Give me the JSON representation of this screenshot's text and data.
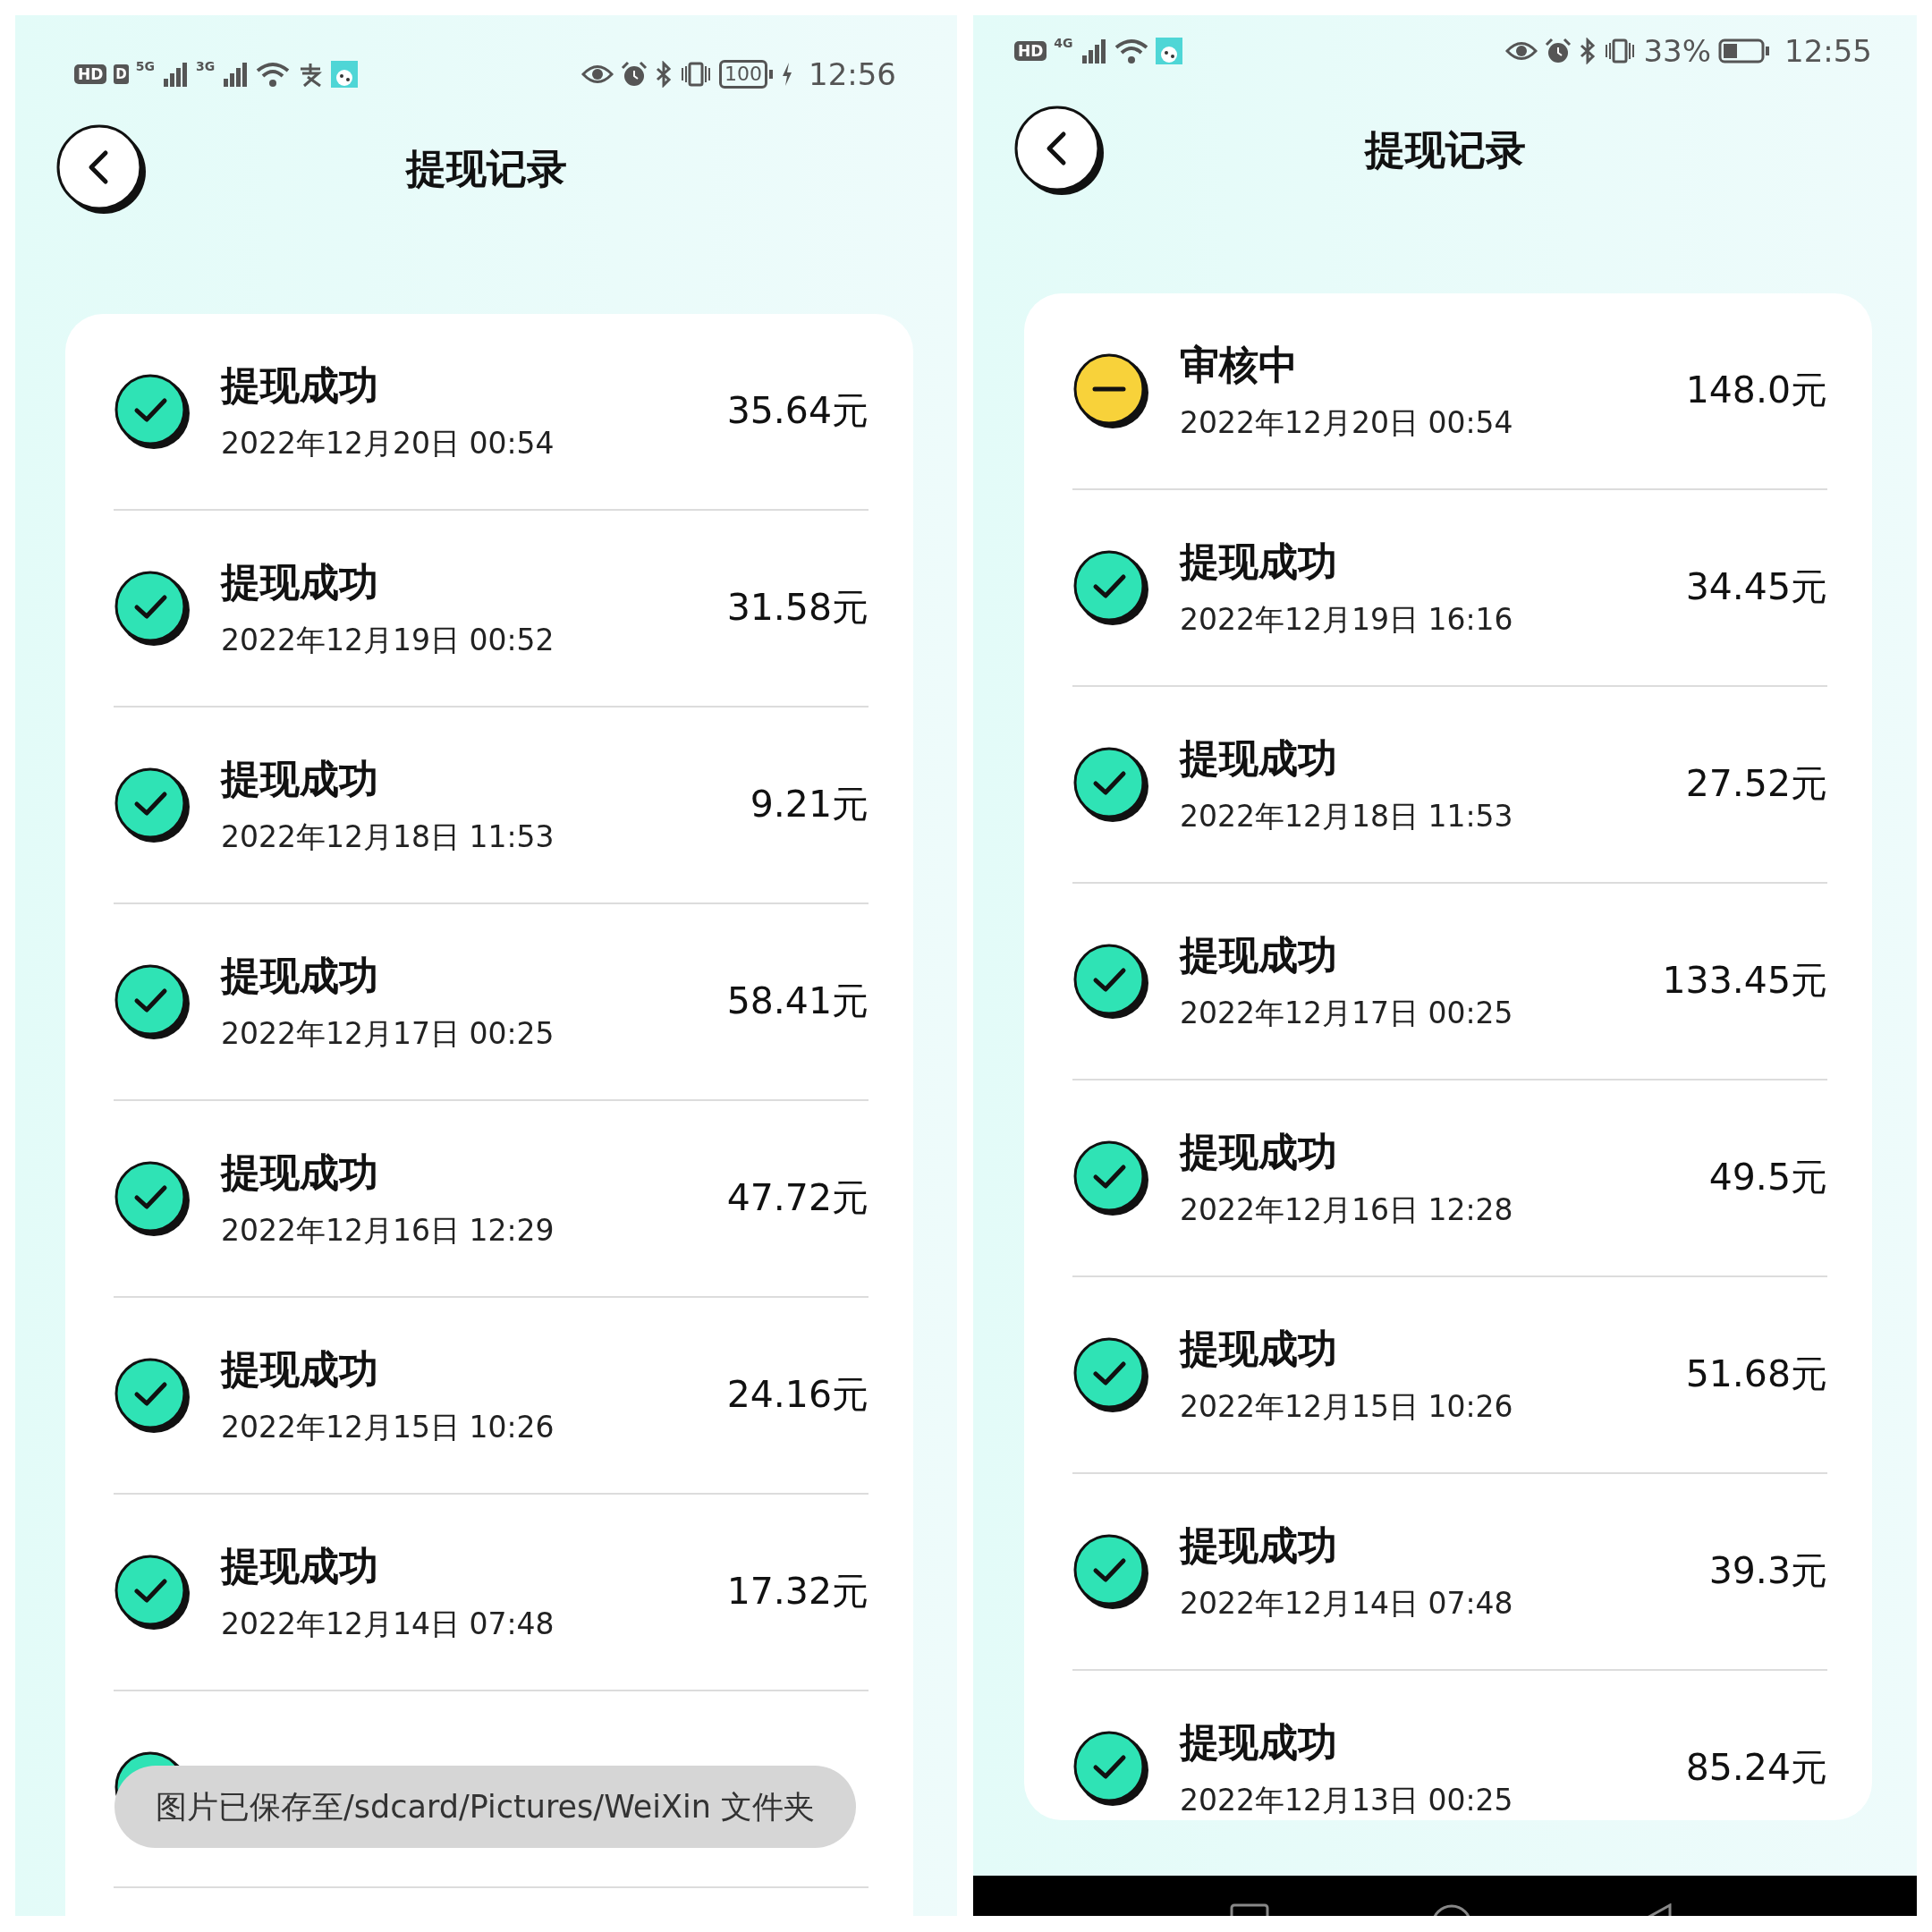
{
  "screens": [
    {
      "status_bar": {
        "hd": "HD",
        "sim_badge": "D",
        "networks": [
          "5G",
          "3G"
        ],
        "left_icons": [
          {
            "kind": "wifi"
          },
          {
            "kind": "alipay"
          },
          {
            "kind": "app"
          }
        ],
        "right_icons": [
          {
            "kind": "eye"
          },
          {
            "kind": "alarm"
          },
          {
            "kind": "bluetooth"
          },
          {
            "kind": "vibrate"
          },
          {
            "kind": "battery_box",
            "text": "100"
          },
          {
            "kind": "charging"
          }
        ],
        "time": "12:56"
      },
      "title": "提现记录",
      "records": [
        {
          "kind": "success",
          "title": "提现成功",
          "date": "2022年12月20日 00:54",
          "amount": "35.64元"
        },
        {
          "kind": "success",
          "title": "提现成功",
          "date": "2022年12月19日 00:52",
          "amount": "31.58元"
        },
        {
          "kind": "success",
          "title": "提现成功",
          "date": "2022年12月18日 11:53",
          "amount": "9.21元"
        },
        {
          "kind": "success",
          "title": "提现成功",
          "date": "2022年12月17日 00:25",
          "amount": "58.41元"
        },
        {
          "kind": "success",
          "title": "提现成功",
          "date": "2022年12月16日 12:29",
          "amount": "47.72元"
        },
        {
          "kind": "success",
          "title": "提现成功",
          "date": "2022年12月15日 10:26",
          "amount": "24.16元"
        },
        {
          "kind": "success",
          "title": "提现成功",
          "date": "2022年12月14日 07:48",
          "amount": "17.32元"
        },
        {
          "kind": "success"
        }
      ],
      "toast": "图片已保存至/sdcard/Pictures/WeiXin 文件夹"
    },
    {
      "status_bar": {
        "hd": "HD",
        "networks": [
          "4G"
        ],
        "left_icons": [
          {
            "kind": "wifi"
          },
          {
            "kind": "app"
          }
        ],
        "right_icons": [
          {
            "kind": "eye"
          },
          {
            "kind": "alarm"
          },
          {
            "kind": "bluetooth"
          },
          {
            "kind": "vibrate"
          },
          {
            "kind": "percent",
            "text": "33%"
          },
          {
            "kind": "battery"
          }
        ],
        "time": "12:55"
      },
      "title": "提现记录",
      "records": [
        {
          "kind": "pending",
          "title": "审核中",
          "date": "2022年12月20日 00:54",
          "amount": "148.0元"
        },
        {
          "kind": "success",
          "title": "提现成功",
          "date": "2022年12月19日 16:16",
          "amount": "34.45元"
        },
        {
          "kind": "success",
          "title": "提现成功",
          "date": "2022年12月18日 11:53",
          "amount": "27.52元"
        },
        {
          "kind": "success",
          "title": "提现成功",
          "date": "2022年12月17日 00:25",
          "amount": "133.45元"
        },
        {
          "kind": "success",
          "title": "提现成功",
          "date": "2022年12月16日 12:28",
          "amount": "49.5元"
        },
        {
          "kind": "success",
          "title": "提现成功",
          "date": "2022年12月15日 10:26",
          "amount": "51.68元"
        },
        {
          "kind": "success",
          "title": "提现成功",
          "date": "2022年12月14日 07:48",
          "amount": "39.3元"
        },
        {
          "kind": "success",
          "title": "提现成功",
          "date": "2022年12月13日 00:25",
          "amount": "85.24元"
        }
      ],
      "nav_bar": {
        "buttons": [
          {
            "kind": "square"
          },
          {
            "kind": "circle"
          },
          {
            "kind": "triangle"
          }
        ]
      }
    }
  ]
}
